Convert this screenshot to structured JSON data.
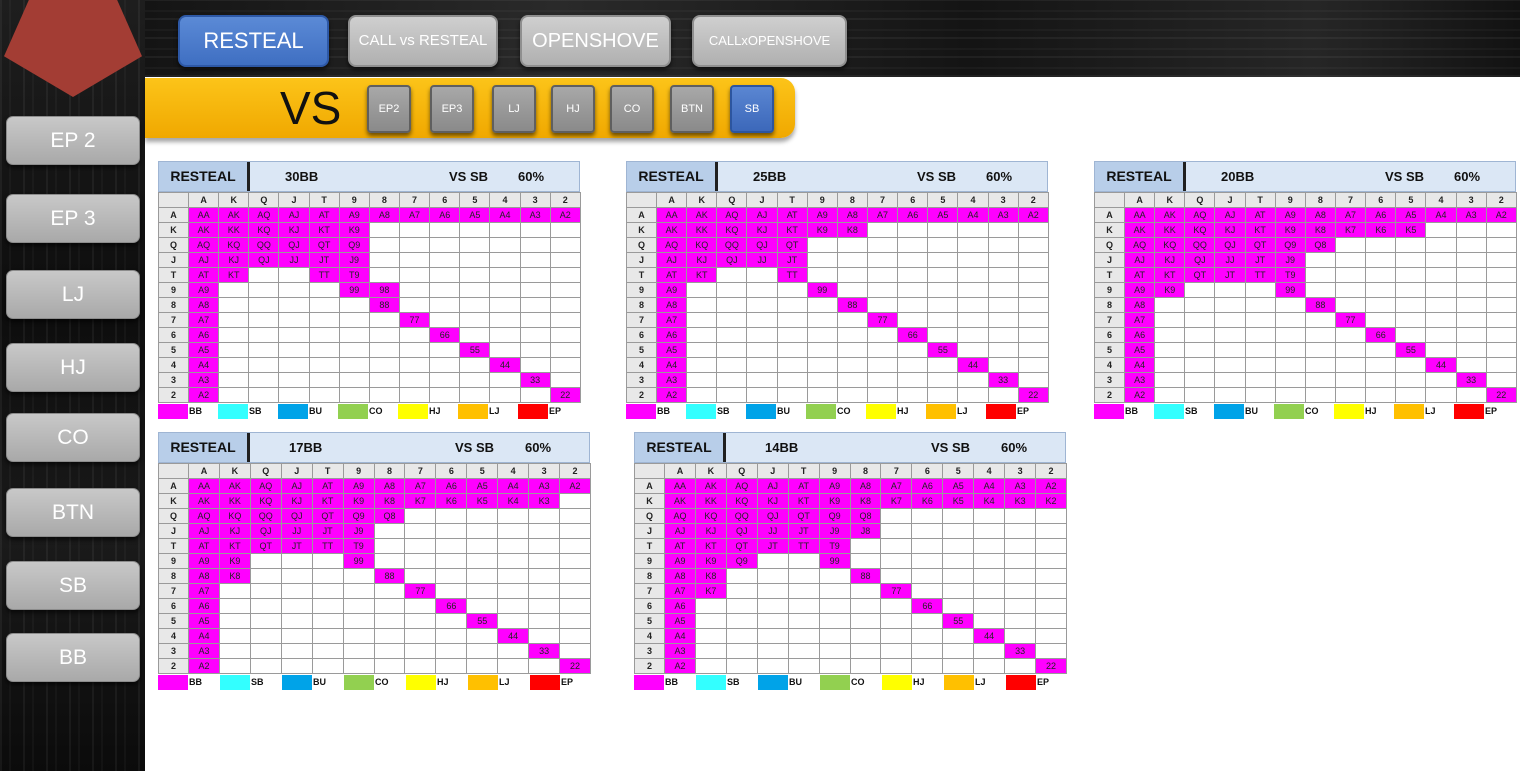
{
  "modes": [
    {
      "label": "RESTEAL",
      "active": true
    },
    {
      "label": "CALL vs RESTEAL",
      "active": false
    },
    {
      "label": "OPENSHOVE",
      "active": false
    },
    {
      "label": "CALLxOPENSHOVE",
      "active": false
    }
  ],
  "positions": [
    "EP 2",
    "EP 3",
    "LJ",
    "HJ",
    "CO",
    "BTN",
    "SB",
    "BB"
  ],
  "vs": {
    "label": "VS",
    "buttons": [
      {
        "label": "EP2",
        "active": false
      },
      {
        "label": "EP3",
        "active": false
      },
      {
        "label": "LJ",
        "active": false
      },
      {
        "label": "HJ",
        "active": false
      },
      {
        "label": "CO",
        "active": false
      },
      {
        "label": "BTN",
        "active": false
      },
      {
        "label": "SB",
        "active": true
      }
    ]
  },
  "ranks": [
    "A",
    "K",
    "Q",
    "J",
    "T",
    "9",
    "8",
    "7",
    "6",
    "5",
    "4",
    "3",
    "2"
  ],
  "legend": [
    {
      "label": "BB",
      "color": "#ff00ff"
    },
    {
      "label": "SB",
      "color": "#33ffff"
    },
    {
      "label": "BU",
      "color": "#00a3e8"
    },
    {
      "label": "CO",
      "color": "#92d050"
    },
    {
      "label": "HJ",
      "color": "#ffff00"
    },
    {
      "label": "LJ",
      "color": "#ffc000"
    },
    {
      "label": "EP",
      "color": "#ff0000"
    }
  ],
  "charts": [
    {
      "tag": "RESTEAL",
      "stack": "30BB",
      "vs": "VS SB",
      "pct": "60%",
      "rows": [
        [
          "AA",
          "AK",
          "AQ",
          "AJ",
          "AT",
          "A9",
          "A8",
          "A7",
          "A6",
          "A5",
          "A4",
          "A3",
          "A2"
        ],
        [
          "AK",
          "KK",
          "KQ",
          "KJ",
          "KT",
          "K9",
          "",
          "",
          "",
          "",
          "",
          "",
          ""
        ],
        [
          "AQ",
          "KQ",
          "QQ",
          "QJ",
          "QT",
          "Q9",
          "",
          "",
          "",
          "",
          "",
          "",
          ""
        ],
        [
          "AJ",
          "KJ",
          "QJ",
          "JJ",
          "JT",
          "J9",
          "",
          "",
          "",
          "",
          "",
          "",
          ""
        ],
        [
          "AT",
          "KT",
          "",
          "",
          "TT",
          "T9",
          "",
          "",
          "",
          "",
          "",
          "",
          ""
        ],
        [
          "A9",
          "",
          "",
          "",
          "",
          "99",
          "98",
          "",
          "",
          "",
          "",
          "",
          ""
        ],
        [
          "A8",
          "",
          "",
          "",
          "",
          "",
          "88",
          "",
          "",
          "",
          "",
          "",
          ""
        ],
        [
          "A7",
          "",
          "",
          "",
          "",
          "",
          "",
          "77",
          "",
          "",
          "",
          "",
          ""
        ],
        [
          "A6",
          "",
          "",
          "",
          "",
          "",
          "",
          "",
          "66",
          "",
          "",
          "",
          ""
        ],
        [
          "A5",
          "",
          "",
          "",
          "",
          "",
          "",
          "",
          "",
          "55",
          "",
          "",
          ""
        ],
        [
          "A4",
          "",
          "",
          "",
          "",
          "",
          "",
          "",
          "",
          "",
          "44",
          "",
          ""
        ],
        [
          "A3",
          "",
          "",
          "",
          "",
          "",
          "",
          "",
          "",
          "",
          "",
          "33",
          ""
        ],
        [
          "A2",
          "",
          "",
          "",
          "",
          "",
          "",
          "",
          "",
          "",
          "",
          "",
          "22"
        ]
      ]
    },
    {
      "tag": "RESTEAL",
      "stack": "25BB",
      "vs": "VS SB",
      "pct": "60%",
      "rows": [
        [
          "AA",
          "AK",
          "AQ",
          "AJ",
          "AT",
          "A9",
          "A8",
          "A7",
          "A6",
          "A5",
          "A4",
          "A3",
          "A2"
        ],
        [
          "AK",
          "KK",
          "KQ",
          "KJ",
          "KT",
          "K9",
          "K8",
          "",
          "",
          "",
          "",
          "",
          ""
        ],
        [
          "AQ",
          "KQ",
          "QQ",
          "QJ",
          "QT",
          "",
          "",
          "",
          "",
          "",
          "",
          "",
          ""
        ],
        [
          "AJ",
          "KJ",
          "QJ",
          "JJ",
          "JT",
          "",
          "",
          "",
          "",
          "",
          "",
          "",
          ""
        ],
        [
          "AT",
          "KT",
          "",
          "",
          "TT",
          "",
          "",
          "",
          "",
          "",
          "",
          "",
          ""
        ],
        [
          "A9",
          "",
          "",
          "",
          "",
          "99",
          "",
          "",
          "",
          "",
          "",
          "",
          ""
        ],
        [
          "A8",
          "",
          "",
          "",
          "",
          "",
          "88",
          "",
          "",
          "",
          "",
          "",
          ""
        ],
        [
          "A7",
          "",
          "",
          "",
          "",
          "",
          "",
          "77",
          "",
          "",
          "",
          "",
          ""
        ],
        [
          "A6",
          "",
          "",
          "",
          "",
          "",
          "",
          "",
          "66",
          "",
          "",
          "",
          ""
        ],
        [
          "A5",
          "",
          "",
          "",
          "",
          "",
          "",
          "",
          "",
          "55",
          "",
          "",
          ""
        ],
        [
          "A4",
          "",
          "",
          "",
          "",
          "",
          "",
          "",
          "",
          "",
          "44",
          "",
          ""
        ],
        [
          "A3",
          "",
          "",
          "",
          "",
          "",
          "",
          "",
          "",
          "",
          "",
          "33",
          ""
        ],
        [
          "A2",
          "",
          "",
          "",
          "",
          "",
          "",
          "",
          "",
          "",
          "",
          "",
          "22"
        ]
      ]
    },
    {
      "tag": "RESTEAL",
      "stack": "20BB",
      "vs": "VS SB",
      "pct": "60%",
      "rows": [
        [
          "AA",
          "AK",
          "AQ",
          "AJ",
          "AT",
          "A9",
          "A8",
          "A7",
          "A6",
          "A5",
          "A4",
          "A3",
          "A2"
        ],
        [
          "AK",
          "KK",
          "KQ",
          "KJ",
          "KT",
          "K9",
          "K8",
          "K7",
          "K6",
          "K5",
          "",
          "",
          ""
        ],
        [
          "AQ",
          "KQ",
          "QQ",
          "QJ",
          "QT",
          "Q9",
          "Q8",
          "",
          "",
          "",
          "",
          "",
          ""
        ],
        [
          "AJ",
          "KJ",
          "QJ",
          "JJ",
          "JT",
          "J9",
          "",
          "",
          "",
          "",
          "",
          "",
          ""
        ],
        [
          "AT",
          "KT",
          "QT",
          "JT",
          "TT",
          "T9",
          "",
          "",
          "",
          "",
          "",
          "",
          ""
        ],
        [
          "A9",
          "K9",
          "",
          "",
          "",
          "99",
          "",
          "",
          "",
          "",
          "",
          "",
          ""
        ],
        [
          "A8",
          "",
          "",
          "",
          "",
          "",
          "88",
          "",
          "",
          "",
          "",
          "",
          ""
        ],
        [
          "A7",
          "",
          "",
          "",
          "",
          "",
          "",
          "77",
          "",
          "",
          "",
          "",
          ""
        ],
        [
          "A6",
          "",
          "",
          "",
          "",
          "",
          "",
          "",
          "66",
          "",
          "",
          "",
          ""
        ],
        [
          "A5",
          "",
          "",
          "",
          "",
          "",
          "",
          "",
          "",
          "55",
          "",
          "",
          ""
        ],
        [
          "A4",
          "",
          "",
          "",
          "",
          "",
          "",
          "",
          "",
          "",
          "44",
          "",
          ""
        ],
        [
          "A3",
          "",
          "",
          "",
          "",
          "",
          "",
          "",
          "",
          "",
          "",
          "33",
          ""
        ],
        [
          "A2",
          "",
          "",
          "",
          "",
          "",
          "",
          "",
          "",
          "",
          "",
          "",
          "22"
        ]
      ]
    },
    {
      "tag": "RESTEAL",
      "stack": "17BB",
      "vs": "VS SB",
      "pct": "60%",
      "rows": [
        [
          "AA",
          "AK",
          "AQ",
          "AJ",
          "AT",
          "A9",
          "A8",
          "A7",
          "A6",
          "A5",
          "A4",
          "A3",
          "A2"
        ],
        [
          "AK",
          "KK",
          "KQ",
          "KJ",
          "KT",
          "K9",
          "K8",
          "K7",
          "K6",
          "K5",
          "K4",
          "K3",
          ""
        ],
        [
          "AQ",
          "KQ",
          "QQ",
          "QJ",
          "QT",
          "Q9",
          "Q8",
          "",
          "",
          "",
          "",
          "",
          ""
        ],
        [
          "AJ",
          "KJ",
          "QJ",
          "JJ",
          "JT",
          "J9",
          "",
          "",
          "",
          "",
          "",
          "",
          ""
        ],
        [
          "AT",
          "KT",
          "QT",
          "JT",
          "TT",
          "T9",
          "",
          "",
          "",
          "",
          "",
          "",
          ""
        ],
        [
          "A9",
          "K9",
          "",
          "",
          "",
          "99",
          "",
          "",
          "",
          "",
          "",
          "",
          ""
        ],
        [
          "A8",
          "K8",
          "",
          "",
          "",
          "",
          "88",
          "",
          "",
          "",
          "",
          "",
          ""
        ],
        [
          "A7",
          "",
          "",
          "",
          "",
          "",
          "",
          "77",
          "",
          "",
          "",
          "",
          ""
        ],
        [
          "A6",
          "",
          "",
          "",
          "",
          "",
          "",
          "",
          "66",
          "",
          "",
          "",
          ""
        ],
        [
          "A5",
          "",
          "",
          "",
          "",
          "",
          "",
          "",
          "",
          "55",
          "",
          "",
          ""
        ],
        [
          "A4",
          "",
          "",
          "",
          "",
          "",
          "",
          "",
          "",
          "",
          "44",
          "",
          ""
        ],
        [
          "A3",
          "",
          "",
          "",
          "",
          "",
          "",
          "",
          "",
          "",
          "",
          "33",
          ""
        ],
        [
          "A2",
          "",
          "",
          "",
          "",
          "",
          "",
          "",
          "",
          "",
          "",
          "",
          "22"
        ]
      ]
    },
    {
      "tag": "RESTEAL",
      "stack": "14BB",
      "vs": "VS SB",
      "pct": "60%",
      "rows": [
        [
          "AA",
          "AK",
          "AQ",
          "AJ",
          "AT",
          "A9",
          "A8",
          "A7",
          "A6",
          "A5",
          "A4",
          "A3",
          "A2"
        ],
        [
          "AK",
          "KK",
          "KQ",
          "KJ",
          "KT",
          "K9",
          "K8",
          "K7",
          "K6",
          "K5",
          "K4",
          "K3",
          "K2"
        ],
        [
          "AQ",
          "KQ",
          "QQ",
          "QJ",
          "QT",
          "Q9",
          "Q8",
          "",
          "",
          "",
          "",
          "",
          ""
        ],
        [
          "AJ",
          "KJ",
          "QJ",
          "JJ",
          "JT",
          "J9",
          "J8",
          "",
          "",
          "",
          "",
          "",
          ""
        ],
        [
          "AT",
          "KT",
          "QT",
          "JT",
          "TT",
          "T9",
          "",
          "",
          "",
          "",
          "",
          "",
          ""
        ],
        [
          "A9",
          "K9",
          "Q9",
          "",
          "",
          "99",
          "",
          "",
          "",
          "",
          "",
          "",
          ""
        ],
        [
          "A8",
          "K8",
          "",
          "",
          "",
          "",
          "88",
          "",
          "",
          "",
          "",
          "",
          ""
        ],
        [
          "A7",
          "K7",
          "",
          "",
          "",
          "",
          "",
          "77",
          "",
          "",
          "",
          "",
          ""
        ],
        [
          "A6",
          "",
          "",
          "",
          "",
          "",
          "",
          "",
          "66",
          "",
          "",
          "",
          ""
        ],
        [
          "A5",
          "",
          "",
          "",
          "",
          "",
          "",
          "",
          "",
          "55",
          "",
          "",
          ""
        ],
        [
          "A4",
          "",
          "",
          "",
          "",
          "",
          "",
          "",
          "",
          "",
          "44",
          "",
          ""
        ],
        [
          "A3",
          "",
          "",
          "",
          "",
          "",
          "",
          "",
          "",
          "",
          "",
          "33",
          ""
        ],
        [
          "A2",
          "",
          "",
          "",
          "",
          "",
          "",
          "",
          "",
          "",
          "",
          "",
          "22"
        ]
      ]
    }
  ]
}
